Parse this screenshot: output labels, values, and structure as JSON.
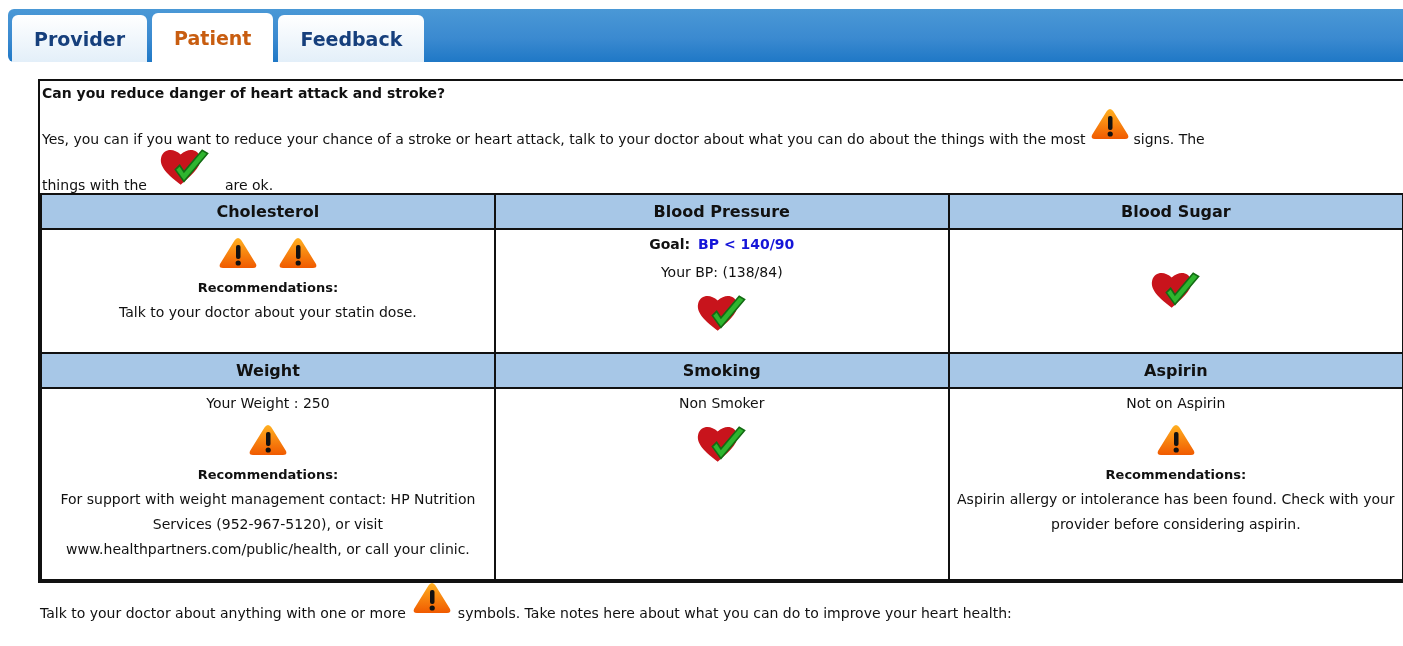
{
  "tabs": [
    {
      "label": "Provider",
      "selected": false
    },
    {
      "label": "Patient",
      "selected": true
    },
    {
      "label": "Feedback",
      "selected": false
    }
  ],
  "intro": {
    "heading": "Can you reduce danger of heart attack and stroke?",
    "paragraph": [
      {
        "kind": "text",
        "text": "Yes, you can if you want to reduce your chance of a stroke or heart attack, talk to your doctor about what you can do about the things with the most"
      },
      {
        "kind": "warning"
      },
      {
        "kind": "text",
        "text": "signs. The"
      },
      {
        "kind": "text",
        "text": "things with the"
      },
      {
        "kind": "ok"
      },
      {
        "kind": "text",
        "text": "are ok."
      }
    ]
  },
  "table": {
    "rows": [
      [
        {
          "heading": "Cholesterol",
          "items": [
            {
              "kind": "icons",
              "icons": [
                {
                  "kind": "warning"
                },
                {
                  "kind": "warning"
                }
              ]
            },
            {
              "kind": "label",
              "text": "Recommendations:"
            },
            {
              "kind": "text",
              "text": "Talk to your doctor about your statin dose."
            }
          ]
        },
        {
          "heading": "Blood Pressure",
          "items": [
            {
              "kind": "goal",
              "label": "Goal:",
              "value": "BP < 140/90"
            },
            {
              "kind": "text",
              "text": "Your BP: (138/84)"
            },
            {
              "kind": "icons",
              "icons": [
                {
                  "kind": "ok"
                }
              ]
            }
          ]
        },
        {
          "heading": "Blood Sugar",
          "items": [
            {
              "kind": "icons",
              "icons": [
                {
                  "kind": "ok"
                }
              ]
            }
          ]
        }
      ],
      [
        {
          "heading": "Weight",
          "items": [
            {
              "kind": "text",
              "text": "Your Weight : 250"
            },
            {
              "kind": "icons",
              "icons": [
                {
                  "kind": "warning"
                }
              ]
            },
            {
              "kind": "label",
              "text": "Recommendations:"
            },
            {
              "kind": "text",
              "text": "For support with weight management contact: HP Nutrition Services (952-967-5120), or visit www.healthpartners.com/public/health, or call your clinic."
            }
          ]
        },
        {
          "heading": "Smoking",
          "items": [
            {
              "kind": "text",
              "text": "Non Smoker"
            },
            {
              "kind": "icons",
              "icons": [
                {
                  "kind": "ok"
                }
              ]
            }
          ]
        },
        {
          "heading": "Aspirin",
          "items": [
            {
              "kind": "text",
              "text": "Not on Aspirin"
            },
            {
              "kind": "icons",
              "icons": [
                {
                  "kind": "warning"
                }
              ]
            },
            {
              "kind": "label",
              "text": "Recommendations:"
            },
            {
              "kind": "text",
              "text": "Aspirin allergy or intolerance has been found. Check with your provider before considering aspirin."
            }
          ]
        }
      ]
    ]
  },
  "footer": [
    {
      "kind": "text",
      "text": "Talk to your doctor about anything with one or more"
    },
    {
      "kind": "warning"
    },
    {
      "kind": "text",
      "text": "symbols. Take notes here about what you can do to improve your heart health:"
    }
  ]
}
